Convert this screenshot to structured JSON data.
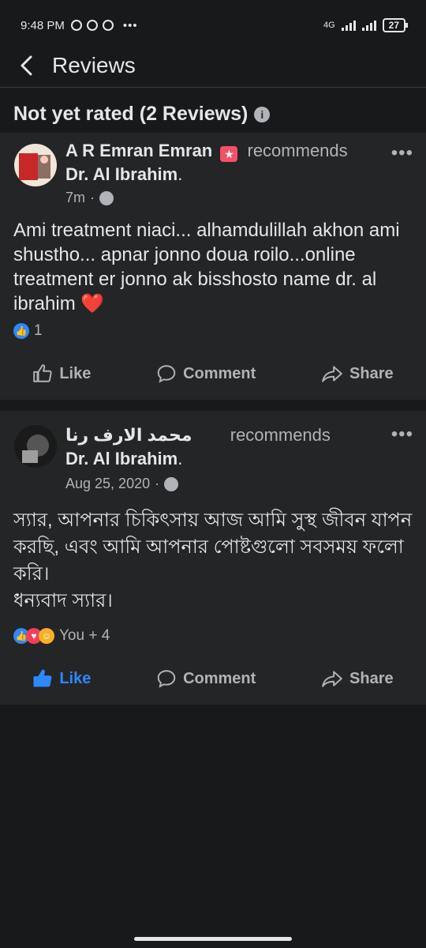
{
  "status_bar": {
    "time": "9:48 PM",
    "network": "4G",
    "battery": "27"
  },
  "header": {
    "title": "Reviews"
  },
  "section": {
    "title": "Not yet rated (2 Reviews)"
  },
  "reviews": [
    {
      "author": "A R Emran Emran",
      "verb": "recommends",
      "target": "Dr. Al Ibrahim",
      "time": "7m",
      "text": "Ami treatment niaci... alhamdulillah akhon ami shustho... apnar jonno doua roilo...online treatment er jonno ak bisshosto name dr. al ibrahim ❤️",
      "reaction_count": "1"
    },
    {
      "author": "محمد الارف رنا",
      "verb": "recommends",
      "target": "Dr. Al Ibrahim",
      "time": "Aug 25, 2020",
      "text": "স্যার, আপনার চিকিৎসায় আজ আমি সুস্থ জীবন যাপন করছি, এবং আমি আপনার পোষ্টগুলো সবসময় ফলো করি।\nধন্যবাদ স্যার।",
      "reaction_count": "You + 4"
    }
  ],
  "actions": {
    "like": "Like",
    "comment": "Comment",
    "share": "Share"
  },
  "colors": {
    "background": "#18191a",
    "card": "#242526",
    "accent": "#2d88ff",
    "text": "#e4e6eb",
    "muted": "#b0b3b8"
  }
}
